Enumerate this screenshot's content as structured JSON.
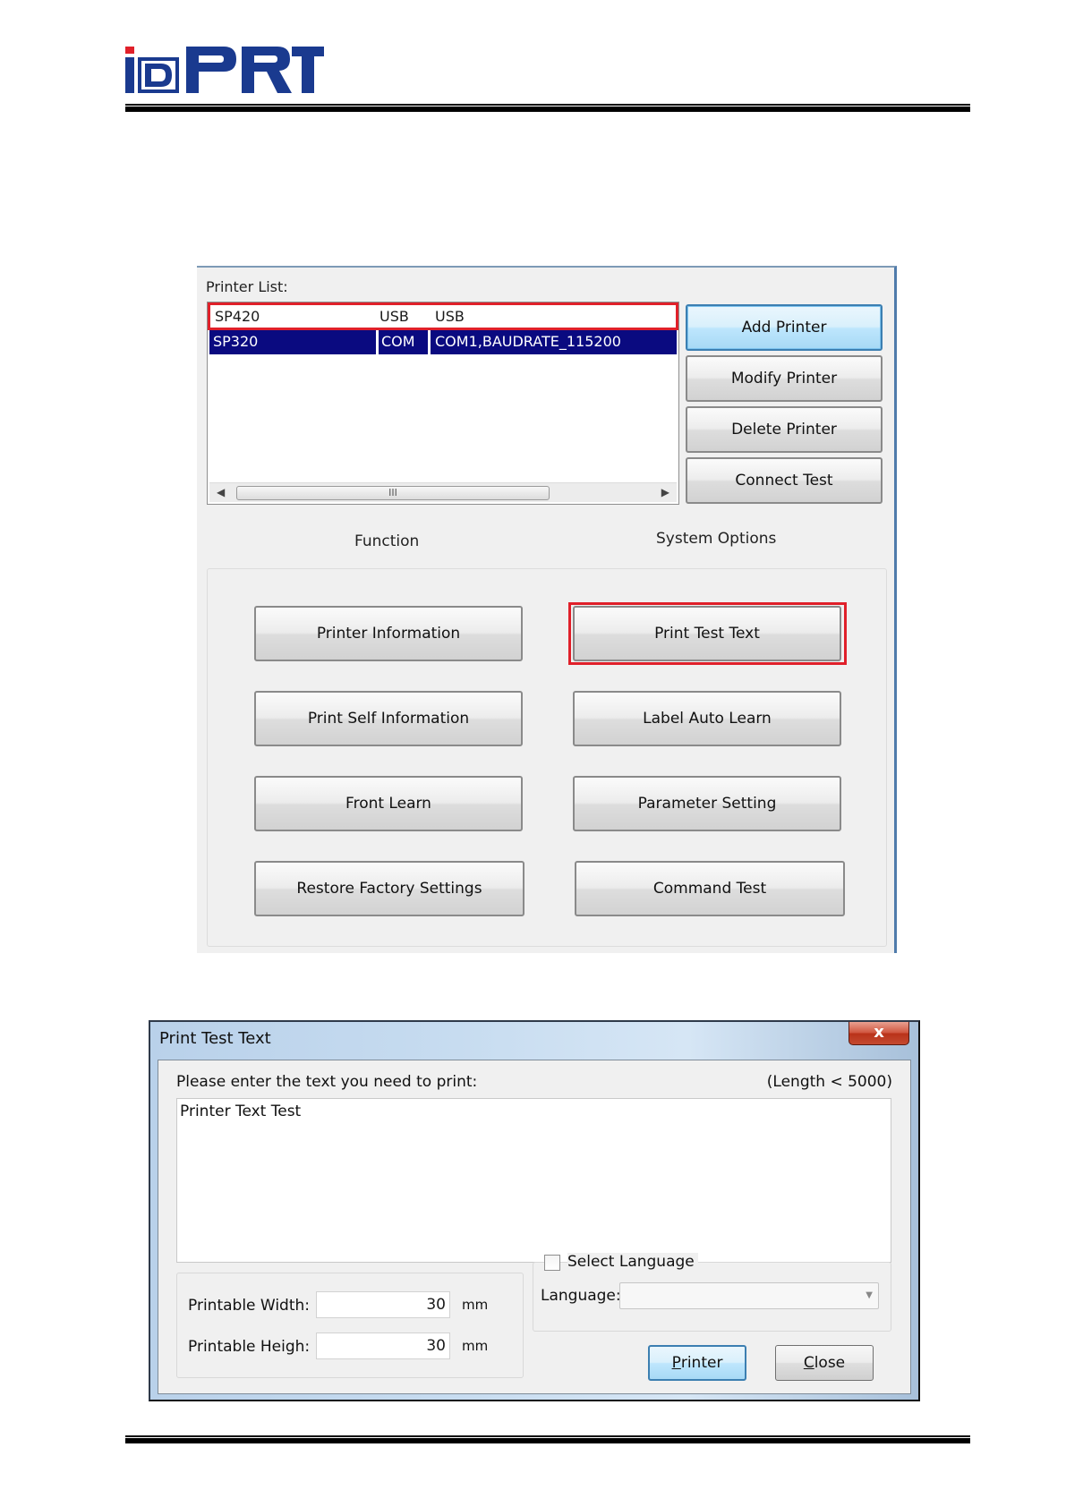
{
  "brand": {
    "logo_text": "iDPRT",
    "logo_color": "#1a3a8f"
  },
  "tool": {
    "printer_list_label": "Printer List:",
    "printers": [
      {
        "name": "SP420",
        "port": "USB",
        "param": "USB"
      },
      {
        "name": "SP320",
        "port": "COM",
        "param": "COM1,BAUDRATE_115200"
      }
    ],
    "scrollbar_grip": "III",
    "side_buttons": {
      "add": "Add Printer",
      "modify": "Modify Printer",
      "delete": "Delete Printer",
      "connect": "Connect Test"
    },
    "sections": {
      "function": "Function",
      "system_options": "System Options"
    },
    "function_buttons": {
      "printer_information": "Printer Information",
      "print_test_text": "Print Test Text",
      "print_self_information": "Print Self Information",
      "label_auto_learn": "Label Auto Learn",
      "front_learn": "Front Learn",
      "parameter_setting": "Parameter Setting",
      "restore_factory_settings": "Restore Factory Settings",
      "command_test": "Command Test"
    },
    "highlight_color": "#e0202a",
    "selection_color": "#0a0a80"
  },
  "dialog": {
    "title": "Print Test Text",
    "close_glyph": "x",
    "prompt": "Please enter the text you need to print:",
    "length_note": "(Length < 5000)",
    "text_value": "Printer Text Test",
    "width_label": "Printable Width:",
    "width_value": "30",
    "height_label": "Printable Heigh:",
    "height_value": "30",
    "unit": "mm",
    "select_language_label": "Select Language",
    "select_language_checked": false,
    "language_label": "Language:",
    "language_value": "",
    "printer_button_rest": "rinter",
    "printer_button_key": "P",
    "close_button_key": "C",
    "close_button_rest": "lose"
  }
}
